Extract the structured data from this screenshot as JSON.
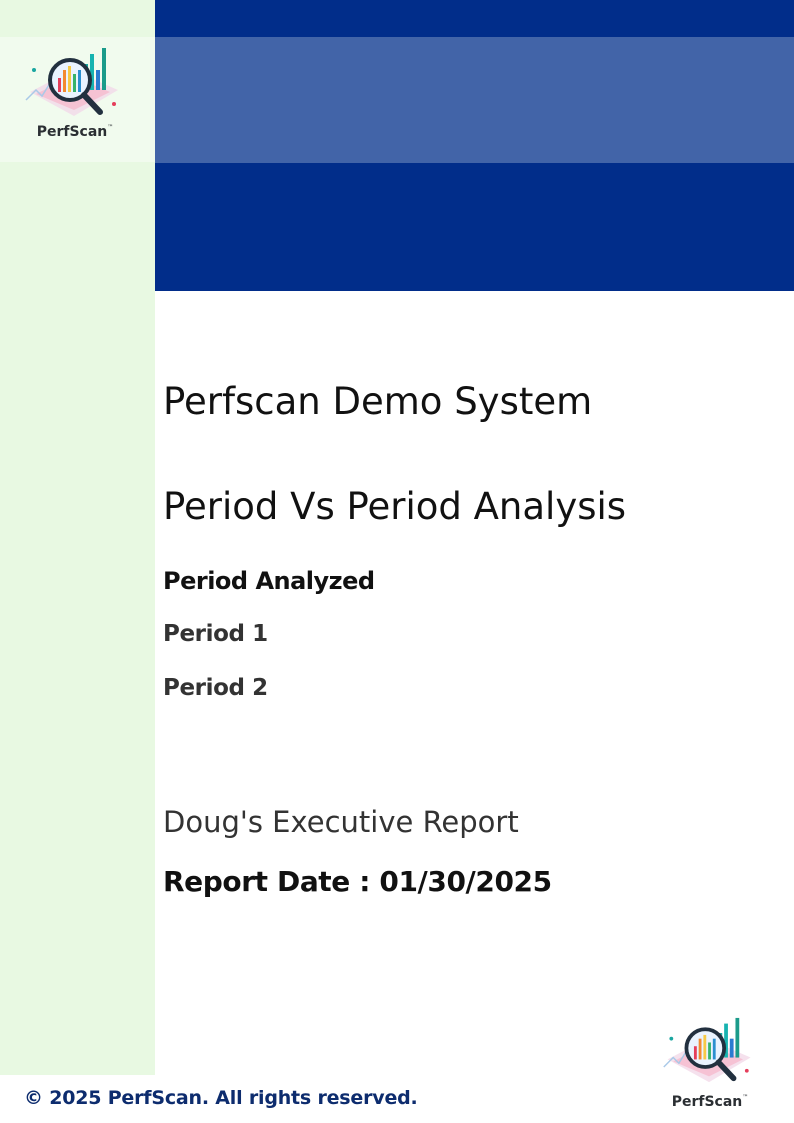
{
  "brand": {
    "name": "PerfScan",
    "trademark": "™"
  },
  "cover": {
    "title": "Perfscan Demo System",
    "subtitle": "Period Vs Period Analysis",
    "period_heading": "Period Analyzed",
    "periods": [
      "Period 1",
      "Period 2"
    ],
    "report_name": "Doug's Executive Report",
    "report_date": "Report Date : 01/30/2025"
  },
  "footer": {
    "copyright": "© 2025 PerfScan. All rights reserved."
  },
  "colors": {
    "banner_dark": "#012d8a",
    "banner_light": "#4264a8",
    "sidebar": "#e8f9e2",
    "footer_text": "#0d2c6e"
  },
  "icons": [
    "magnifier-chart-logo-icon"
  ]
}
